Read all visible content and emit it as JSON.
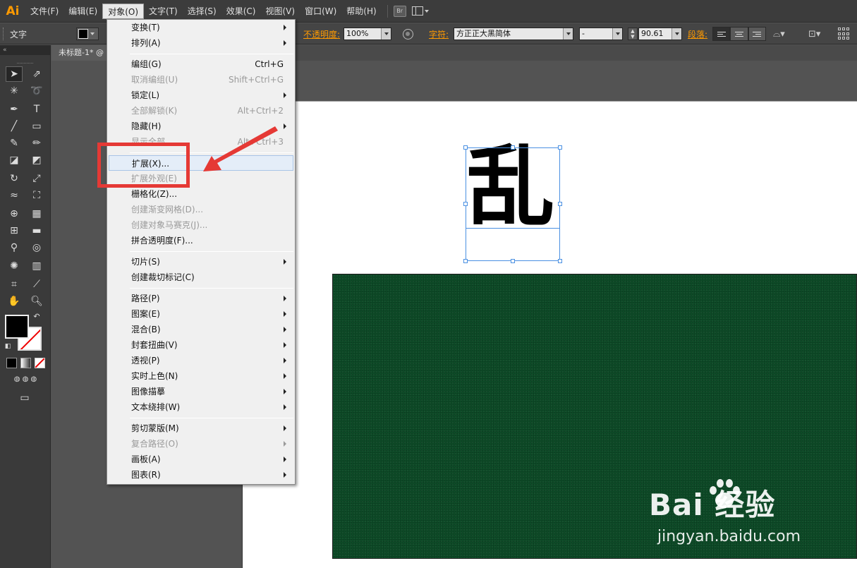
{
  "app": {
    "logo": "Ai"
  },
  "menubar": {
    "items": [
      "文件(F)",
      "编辑(E)",
      "对象(O)",
      "文字(T)",
      "选择(S)",
      "效果(C)",
      "视图(V)",
      "窗口(W)",
      "帮助(H)"
    ],
    "active": "对象(O)",
    "bridge_label": "Br"
  },
  "controlbar": {
    "mode_label": "文字",
    "opacity_label": "不透明度:",
    "opacity_value": "100%",
    "char_label": "字符:",
    "font_name": "方正正大黑简体",
    "font_style": "-",
    "font_size": "90.61",
    "para_label": "段落:"
  },
  "document": {
    "tab_title": "未标题-1* @"
  },
  "artwork": {
    "character": "乱",
    "board_color": "#0d4b27"
  },
  "object_menu": {
    "items": [
      {
        "label": "变换(T)",
        "shortcut": "",
        "submenu": true,
        "disabled": false
      },
      {
        "label": "排列(A)",
        "shortcut": "",
        "submenu": true,
        "disabled": false
      },
      {
        "label": "编组(G)",
        "shortcut": "Ctrl+G",
        "submenu": false,
        "disabled": false
      },
      {
        "label": "取消编组(U)",
        "shortcut": "Shift+Ctrl+G",
        "submenu": false,
        "disabled": true
      },
      {
        "label": "锁定(L)",
        "shortcut": "",
        "submenu": true,
        "disabled": false
      },
      {
        "label": "全部解锁(K)",
        "shortcut": "Alt+Ctrl+2",
        "submenu": false,
        "disabled": true
      },
      {
        "label": "隐藏(H)",
        "shortcut": "",
        "submenu": true,
        "disabled": false
      },
      {
        "label": "显示全部",
        "shortcut": "Alt+Ctrl+3",
        "submenu": false,
        "disabled": true
      },
      {
        "label": "扩展(X)...",
        "shortcut": "",
        "submenu": false,
        "disabled": false,
        "highlighted": true
      },
      {
        "label": "扩展外观(E)",
        "shortcut": "",
        "submenu": false,
        "disabled": true
      },
      {
        "label": "栅格化(Z)...",
        "shortcut": "",
        "submenu": false,
        "disabled": false
      },
      {
        "label": "创建渐变网格(D)...",
        "shortcut": "",
        "submenu": false,
        "disabled": true
      },
      {
        "label": "创建对象马赛克(J)...",
        "shortcut": "",
        "submenu": false,
        "disabled": true
      },
      {
        "label": "拼合透明度(F)...",
        "shortcut": "",
        "submenu": false,
        "disabled": false
      },
      {
        "label": "切片(S)",
        "shortcut": "",
        "submenu": true,
        "disabled": false
      },
      {
        "label": "创建裁切标记(C)",
        "shortcut": "",
        "submenu": false,
        "disabled": false
      },
      {
        "label": "路径(P)",
        "shortcut": "",
        "submenu": true,
        "disabled": false
      },
      {
        "label": "图案(E)",
        "shortcut": "",
        "submenu": true,
        "disabled": false
      },
      {
        "label": "混合(B)",
        "shortcut": "",
        "submenu": true,
        "disabled": false
      },
      {
        "label": "封套扭曲(V)",
        "shortcut": "",
        "submenu": true,
        "disabled": false
      },
      {
        "label": "透视(P)",
        "shortcut": "",
        "submenu": true,
        "disabled": false
      },
      {
        "label": "实时上色(N)",
        "shortcut": "",
        "submenu": true,
        "disabled": false
      },
      {
        "label": "图像描摹",
        "shortcut": "",
        "submenu": true,
        "disabled": false
      },
      {
        "label": "文本绕排(W)",
        "shortcut": "",
        "submenu": true,
        "disabled": false
      },
      {
        "label": "剪切蒙版(M)",
        "shortcut": "",
        "submenu": true,
        "disabled": false
      },
      {
        "label": "复合路径(O)",
        "shortcut": "",
        "submenu": true,
        "disabled": true
      },
      {
        "label": "画板(A)",
        "shortcut": "",
        "submenu": true,
        "disabled": false
      },
      {
        "label": "图表(R)",
        "shortcut": "",
        "submenu": true,
        "disabled": false
      }
    ]
  },
  "annotation": {
    "color": "#e53935"
  },
  "watermark": {
    "brand": "Bai 经验",
    "url": "jingyan.baidu.com"
  },
  "colors": {
    "accent_orange": "#ff9a00",
    "selection_blue": "#4a90e2"
  }
}
